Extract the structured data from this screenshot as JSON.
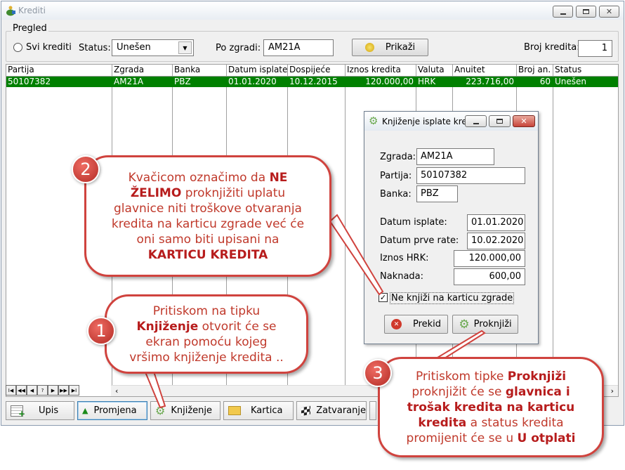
{
  "window": {
    "title": "Krediti",
    "group_label": "Pregled",
    "filters": {
      "svi_krediti_label": "Svi krediti",
      "status_label": "Status:",
      "status_value": "Unešen",
      "po_zgradi_label": "Po zgradi:",
      "po_zgradi_value": "AM21A",
      "prikazi_label": "Prikaži",
      "broj_kredita_label": "Broj kredita:",
      "broj_kredita_value": "1"
    }
  },
  "table": {
    "columns": [
      "Partija",
      "Zgrada",
      "Banka",
      "Datum isplate",
      "Dospijeće",
      "Iznos kredita",
      "Valuta",
      "Anuitet",
      "Broj an.",
      "Status"
    ],
    "rows": [
      [
        "50107382",
        "AM21A",
        "PBZ",
        "01.01.2020",
        "10.12.2015",
        "120.000,00",
        "HRK",
        "223.716,00",
        "60",
        "Unešen"
      ]
    ]
  },
  "navigator": [
    "I◀",
    "◀◀",
    "◀",
    "?",
    "▶",
    "▶▶",
    "▶I"
  ],
  "toolbar": {
    "upis": "Upis",
    "promjena": "Promjena",
    "knjizenje": "Knjiženje",
    "kartica": "Kartica",
    "zatvaranje": "Zatvaranje"
  },
  "dialog": {
    "title": "Knjiženje isplate kre...",
    "zgrada_label": "Zgrada:",
    "zgrada_value": "AM21A",
    "partija_label": "Partija:",
    "partija_value": "50107382",
    "banka_label": "Banka:",
    "banka_value": "PBZ",
    "datum_isplate_label": "Datum isplate:",
    "datum_isplate_value": "01.01.2020",
    "datum_prve_rate_label": "Datum prve rate:",
    "datum_prve_rate_value": "10.02.2020",
    "iznos_label": "Iznos HRK:",
    "iznos_value": "120.000,00",
    "naknada_label": "Naknada:",
    "naknada_value": "600,00",
    "checkbox_label": "Ne knjiži na karticu zgrade",
    "prekid_label": "Prekid",
    "proknjizi_label": "Proknjiži"
  },
  "callouts": {
    "c1": {
      "number": "1",
      "t1": "Pritiskom na tipku",
      "b1": "Knjiženje",
      "t2": " otvorit će se ekran pomoću kojeg vršimo knjiženje kredita .."
    },
    "c2": {
      "number": "2",
      "t1": "Kvačicom označimo da ",
      "b1": "NE ŽELIMO",
      "t2": " proknjižiti  uplatu glavnice niti troškove otvaranja kredita na karticu zgrade već će oni samo biti upisani na ",
      "b2": "KARTICU KREDITA"
    },
    "c3": {
      "number": "3",
      "t1": "Pritiskom tipke ",
      "b1": "Proknjiži",
      "t2": " proknjižit će se ",
      "b2": "glavnica i trošak kredita na karticu kredita",
      "t3": " a status kredita promijenit će se u ",
      "b3": "U otplati"
    }
  },
  "colors": {
    "selected_row": "#008000",
    "callout_border": "#d0433e",
    "callout_text": "#c0392b",
    "badge": "#c0392b"
  }
}
